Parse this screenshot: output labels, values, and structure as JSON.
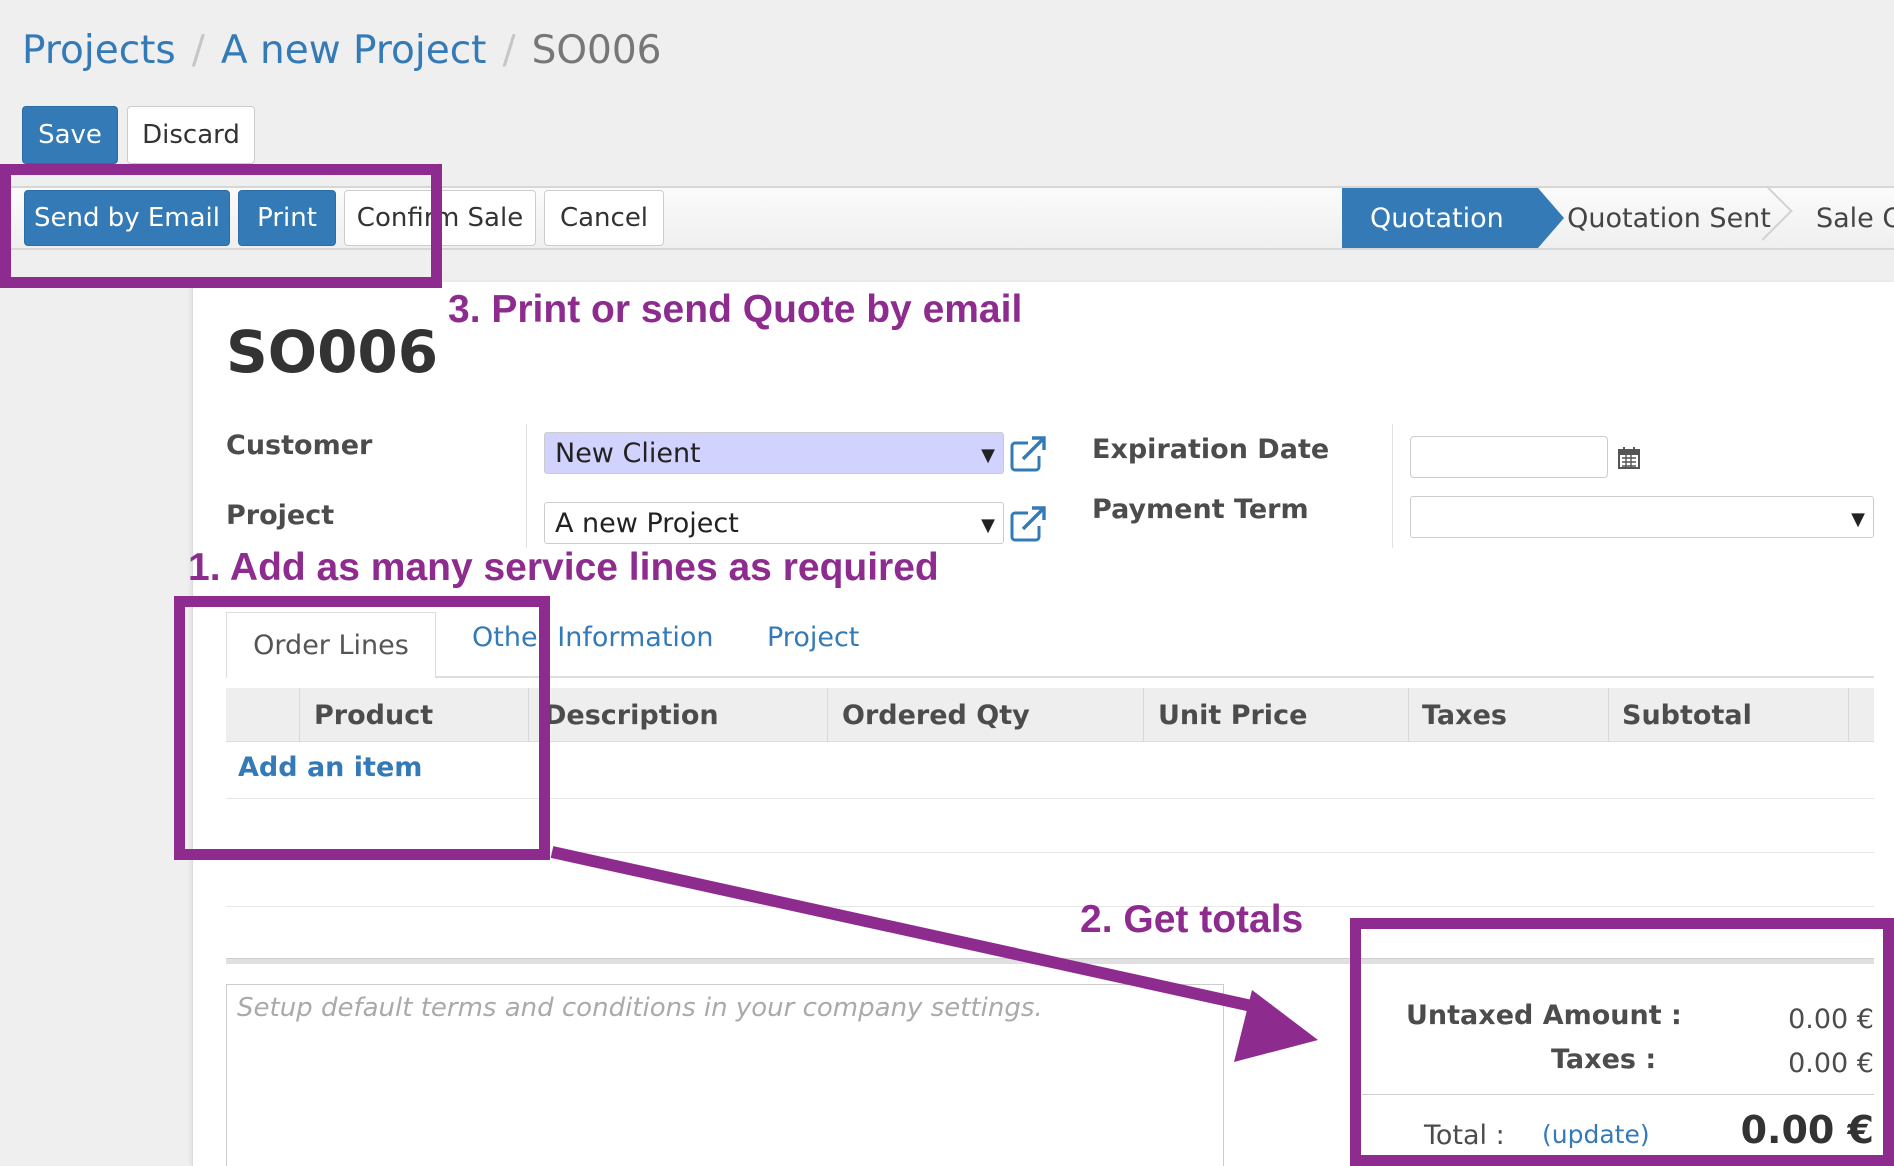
{
  "breadcrumb": {
    "items": [
      "Projects",
      "A new Project"
    ],
    "current": "SO006",
    "separator": "/"
  },
  "toolbar": {
    "save_label": "Save",
    "discard_label": "Discard"
  },
  "header_buttons": {
    "send_email": "Send by Email",
    "print": "Print",
    "confirm_sale": "Confirm Sale",
    "cancel": "Cancel"
  },
  "statusbar": {
    "stages": [
      "Quotation",
      "Quotation Sent",
      "Sale O"
    ],
    "active": "Quotation"
  },
  "form": {
    "title": "SO006",
    "customer_label": "Customer",
    "customer_value": "New Client",
    "project_label": "Project",
    "project_value": "A new Project",
    "expiration_label": "Expiration Date",
    "expiration_value": "",
    "payment_term_label": "Payment Term",
    "payment_term_value": ""
  },
  "tabs": {
    "items": [
      "Order Lines",
      "Other Information",
      "Project"
    ],
    "active": "Order Lines"
  },
  "order_table": {
    "columns": [
      "Product",
      "Description",
      "Ordered Qty",
      "Unit Price",
      "Taxes",
      "Subtotal"
    ],
    "rows": [],
    "add_item_label": "Add an item"
  },
  "notes": {
    "placeholder": "Setup default terms and conditions in your company settings."
  },
  "totals": {
    "untaxed_label": "Untaxed Amount :",
    "untaxed_value": "0.00 €",
    "taxes_label": "Taxes :",
    "taxes_value": "0.00 €",
    "total_label": "Total :",
    "update_label": "(update)",
    "total_value": "0.00 €"
  },
  "annotations": {
    "step1": "1. Add as many service lines as required",
    "step2": "2. Get totals",
    "step3": "3. Print or send Quote by email",
    "color": "#8e2b8e"
  },
  "colors": {
    "primary": "#337ab7",
    "required_field": "#d2d2ff",
    "background": "#efefef"
  },
  "icons": {
    "external_link": "external-link-icon",
    "calendar": "calendar-icon",
    "dropdown": "caret-down-icon"
  }
}
